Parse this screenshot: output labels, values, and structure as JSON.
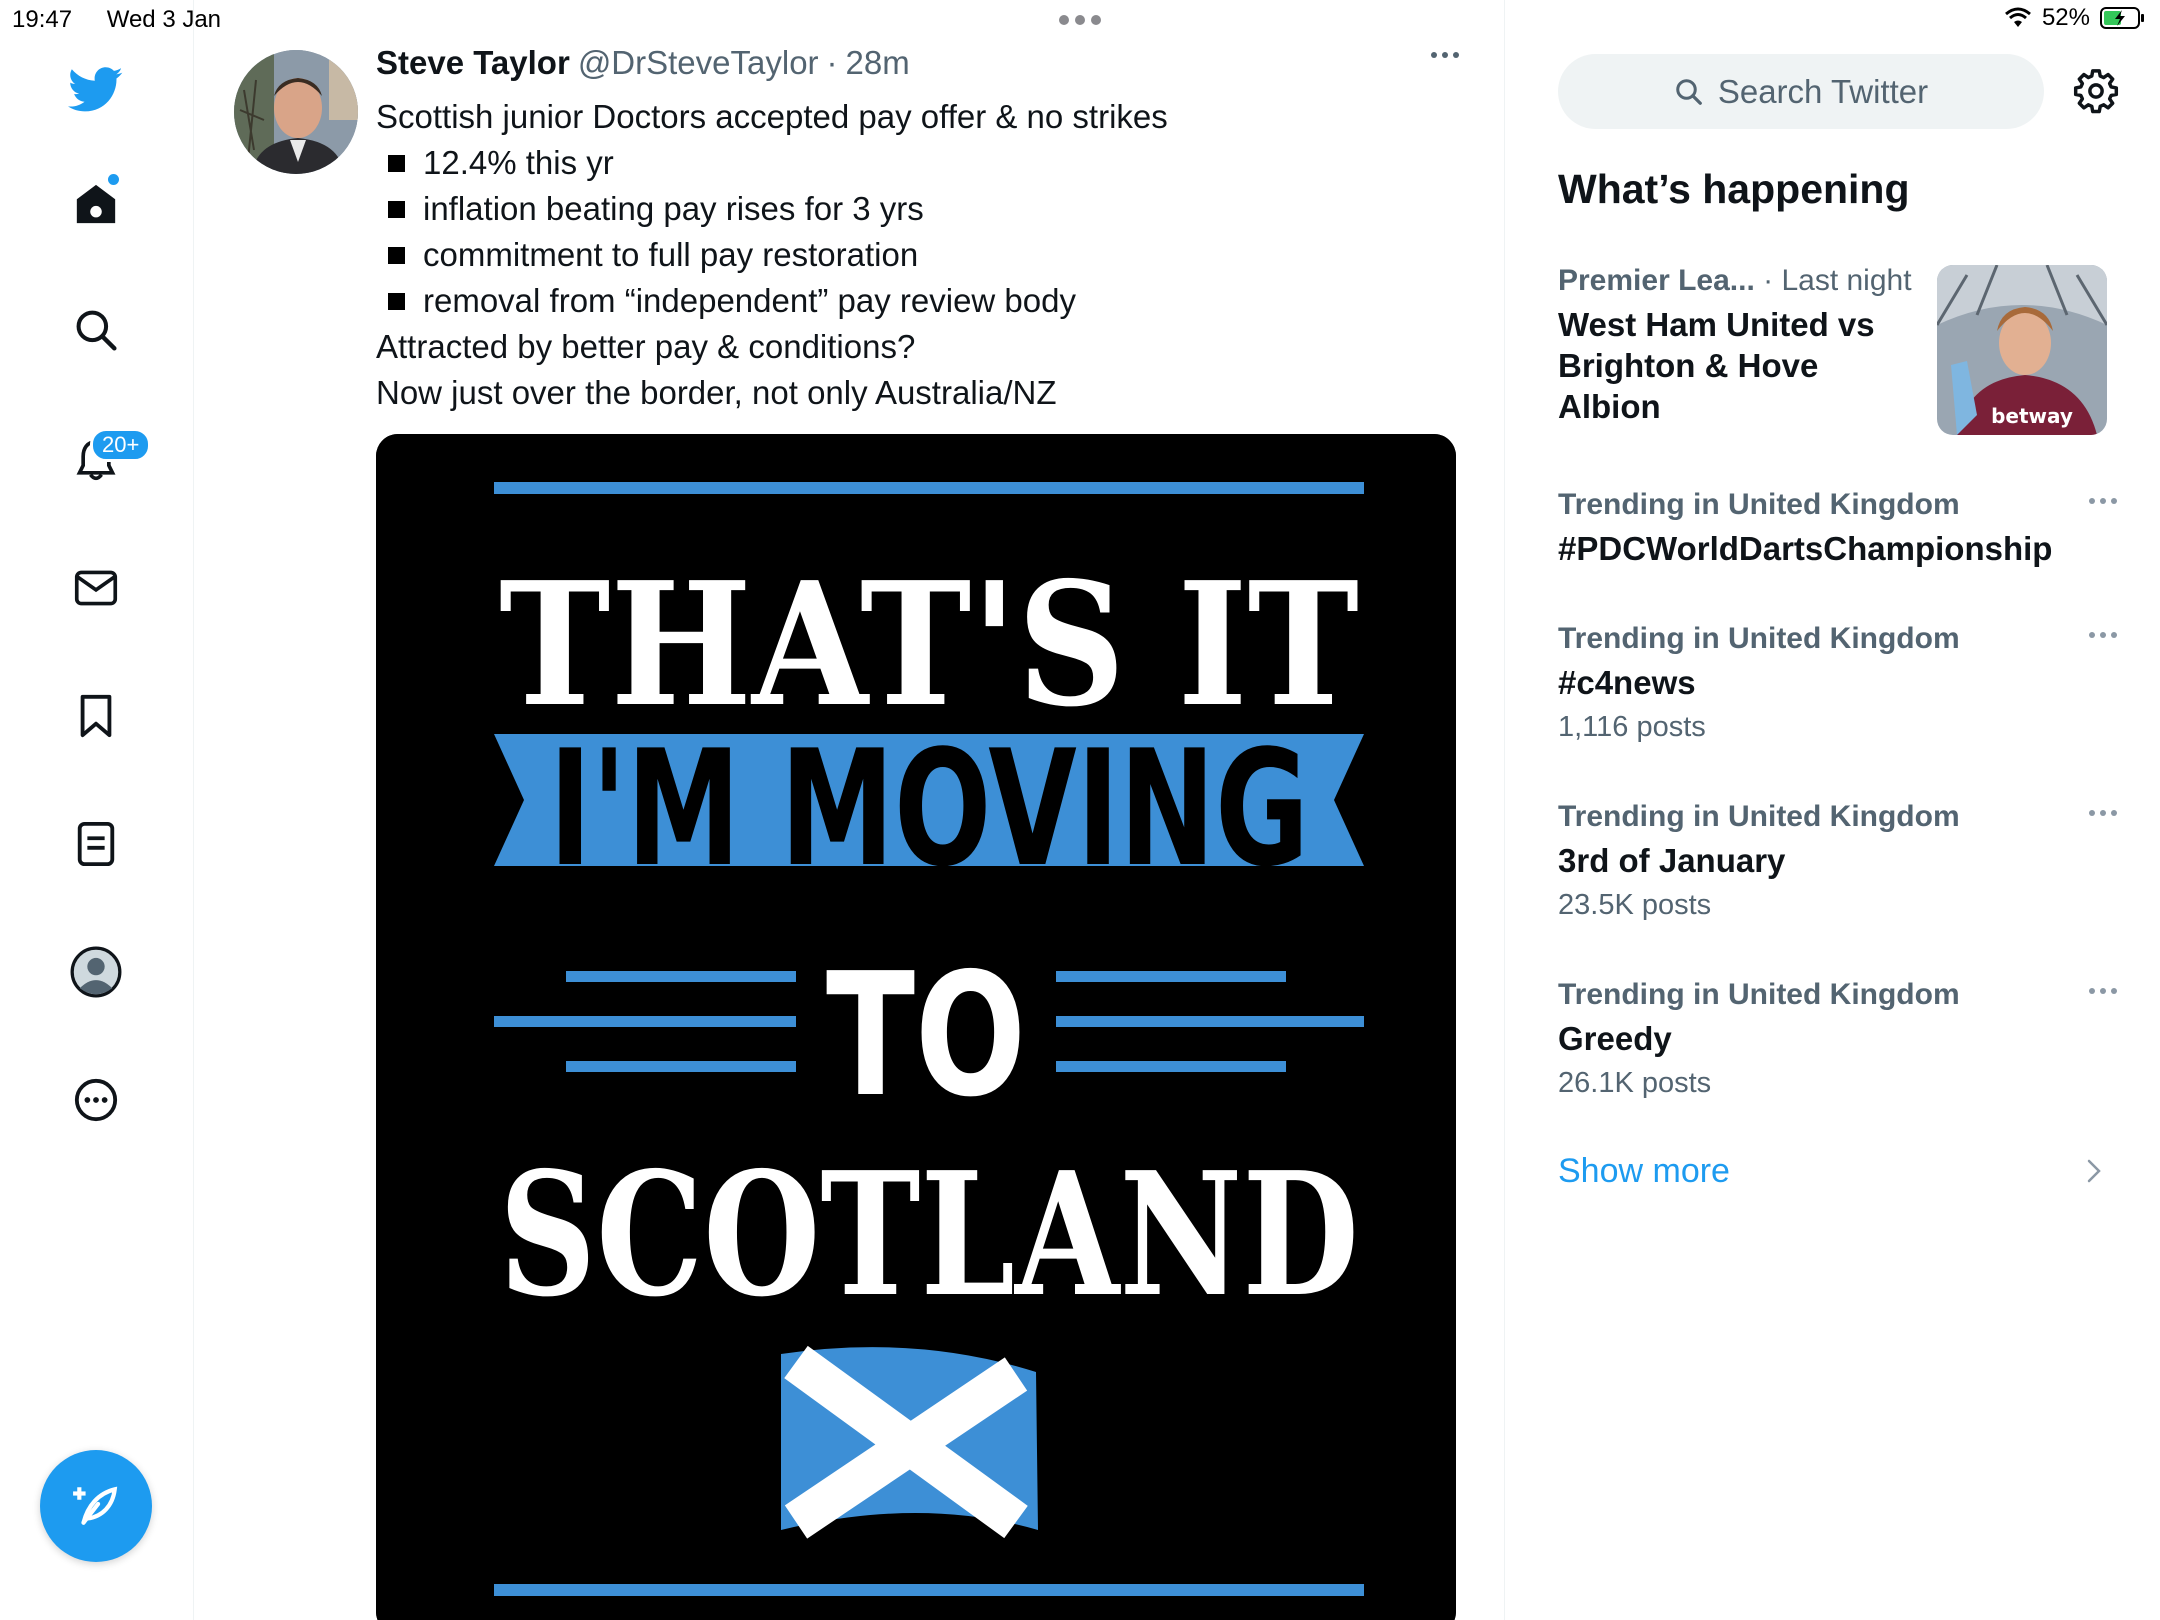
{
  "status_bar": {
    "time": "19:47",
    "date": "Wed 3 Jan",
    "battery": "52%"
  },
  "nav": {
    "items": [
      "Home",
      "Explore",
      "Notifications",
      "Messages",
      "Bookmarks",
      "Lists",
      "Profile",
      "More"
    ],
    "notifications_badge": "20+"
  },
  "tweet": {
    "author_name": "Steve Taylor",
    "author_handle": "@DrSteveTaylor",
    "separator": "·",
    "time": "28m",
    "line1": "Scottish junior Doctors accepted pay offer & no strikes",
    "bullets": [
      "12.4% this yr",
      "inflation beating pay rises for 3 yrs",
      "commitment to full pay restoration",
      "removal from “independent” pay review body"
    ],
    "line2": "Attracted by better pay & conditions?",
    "line3": "Now just over the border, not only Australia/NZ",
    "image": {
      "line1": "THAT'S IT",
      "line2": "I'M MOVING",
      "line3": "TO",
      "line4": "SCOTLAND"
    }
  },
  "sidebar": {
    "search_placeholder": "Search Twitter",
    "section_title": "What’s happening",
    "featured": {
      "context": "Premier Lea...",
      "time": "· Last night",
      "title": "West Ham United vs Brighton & Hove Albion",
      "thumb_text": "betway"
    },
    "trends": [
      {
        "context": "Trending in United Kingdom",
        "name": "#PDCWorldDartsChampionship",
        "count": ""
      },
      {
        "context": "Trending in United Kingdom",
        "name": "#c4news",
        "count": "1,116 posts"
      },
      {
        "context": "Trending in United Kingdom",
        "name": "3rd of January",
        "count": "23.5K posts"
      },
      {
        "context": "Trending in United Kingdom",
        "name": "Greedy",
        "count": "26.1K posts"
      }
    ],
    "show_more": "Show more"
  },
  "colors": {
    "accent": "#1d9bf0",
    "text": "#0f1419",
    "muted": "#536471",
    "saltire_blue": "#3d8fd6"
  }
}
